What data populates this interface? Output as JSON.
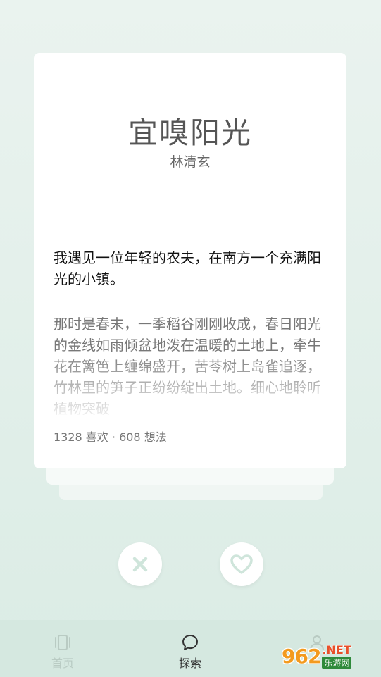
{
  "card": {
    "title": "宜嗅阳光",
    "author": "林清玄",
    "lead": "我遇见一位年轻的农夫，在南方一个充满阳光的小镇。",
    "body": "那时是春末，一季稻谷刚刚收成，春日阳光的金线如雨倾盆地泼在温暖的土地上，牵牛花在篱笆上缠绵盛开，苦苓树上岛雀追逐，竹林里的笋子正纷纷绽出土地。细心地聆听植物突破",
    "stats": "1328 喜欢 · 608 想法"
  },
  "actions": {
    "skip_icon": "close-icon",
    "like_icon": "heart-icon"
  },
  "tabbar": {
    "home_label": "首页",
    "explore_label": "探索"
  },
  "watermark": {
    "num": "962",
    "net": ".NET",
    "cn": "乐游网"
  },
  "colors": {
    "accent": "#cfe5db",
    "background": "#e3f0eb",
    "tabbar": "#d5e8e0"
  }
}
